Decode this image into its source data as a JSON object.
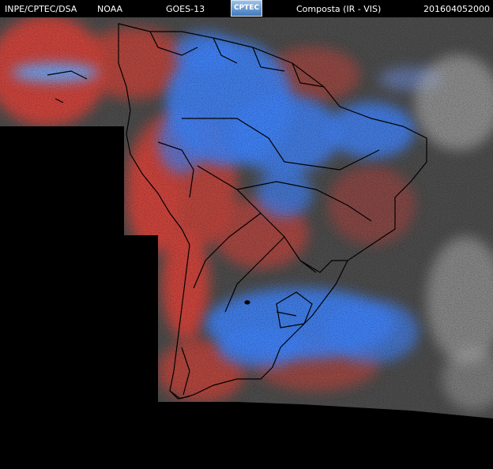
{
  "header": {
    "agency": "INPE/CPTEC/DSA",
    "partner": "NOAA",
    "satellite": "GOES-13",
    "logo_text": "CPTEC",
    "product": "Composta (IR - VIS)",
    "timestamp": "201604052000"
  },
  "colors": {
    "background": "#000000",
    "warm_surface": "#c7423a",
    "cloud_cold_blue": "#3f7ff2",
    "clear_gray": "#4a4a4a",
    "high_cloud_white": "#bcbcbc",
    "borders": "#000000"
  },
  "icons": {
    "logo": "cptec-logo"
  }
}
